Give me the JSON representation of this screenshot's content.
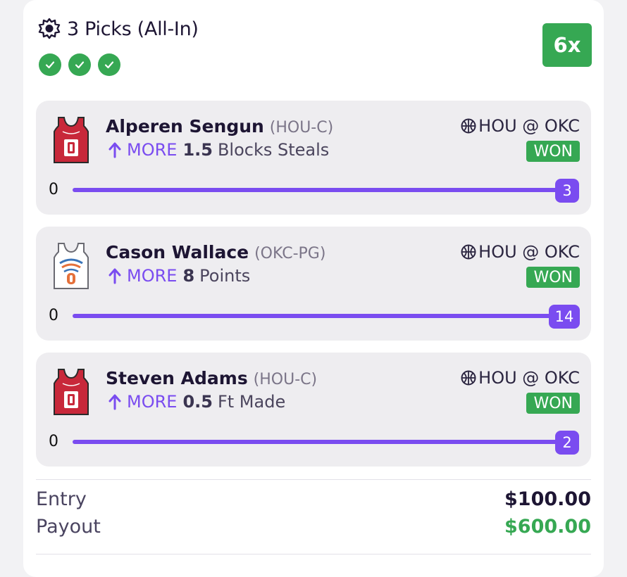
{
  "entry": {
    "title": "3 Picks (All-In)",
    "multiplier": "6x",
    "check_count": 3,
    "accent_color": "#7a4cf0",
    "win_color": "#36a853"
  },
  "picks": [
    {
      "player": "Alperen Sengun",
      "team_pos": "(HOU-C)",
      "direction": "MORE",
      "line": "1.5",
      "stat": "Blocks Steals",
      "game": "HOU @ OKC",
      "result": "WON",
      "progress_min": "0",
      "progress_value": "3",
      "jersey": "rockets-red-jersey-icon"
    },
    {
      "player": "Cason Wallace",
      "team_pos": "(OKC-PG)",
      "direction": "MORE",
      "line": "8",
      "stat": "Points",
      "game": "HOU @ OKC",
      "result": "WON",
      "progress_min": "0",
      "progress_value": "14",
      "jersey": "thunder-white-jersey-icon"
    },
    {
      "player": "Steven Adams",
      "team_pos": "(HOU-C)",
      "direction": "MORE",
      "line": "0.5",
      "stat": "Ft Made",
      "game": "HOU @ OKC",
      "result": "WON",
      "progress_min": "0",
      "progress_value": "2",
      "jersey": "rockets-red-jersey-icon"
    }
  ],
  "summary": {
    "entry_label": "Entry",
    "entry_amount": "$100.00",
    "payout_label": "Payout",
    "payout_amount": "$600.00"
  }
}
